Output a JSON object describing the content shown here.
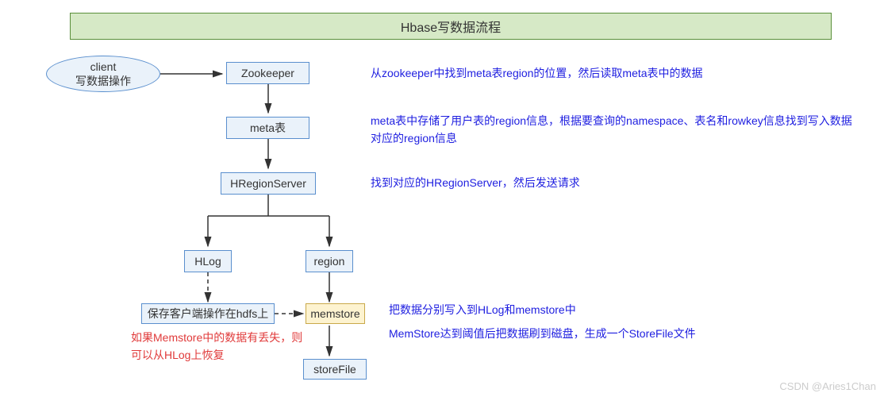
{
  "title": "Hbase写数据流程",
  "nodes": {
    "client_line1": "client",
    "client_line2": "写数据操作",
    "zookeeper": "Zookeeper",
    "meta": "meta表",
    "hregionserver": "HRegionServer",
    "hlog": "HLog",
    "region": "region",
    "hdfs_save": "保存客户端操作在hdfs上",
    "memstore": "memstore",
    "storefile": "storeFile"
  },
  "descriptions": {
    "zookeeper_desc": "从zookeeper中找到meta表region的位置，然后读取meta表中的数据",
    "meta_desc": "meta表中存储了用户表的region信息，根据要查询的namespace、表名和rowkey信息找到写入数据对应的region信息",
    "hregion_desc": "找到对应的HRegionServer，然后发送请求",
    "memstore_desc1": "把数据分别写入到HLog和memstore中",
    "memstore_desc2": "MemStore达到阈值后把数据刷到磁盘，生成一个StoreFile文件",
    "hlog_red": "如果Memstore中的数据有丢失，则可以从HLog上恢复"
  },
  "watermark": "CSDN @Aries1Chan"
}
